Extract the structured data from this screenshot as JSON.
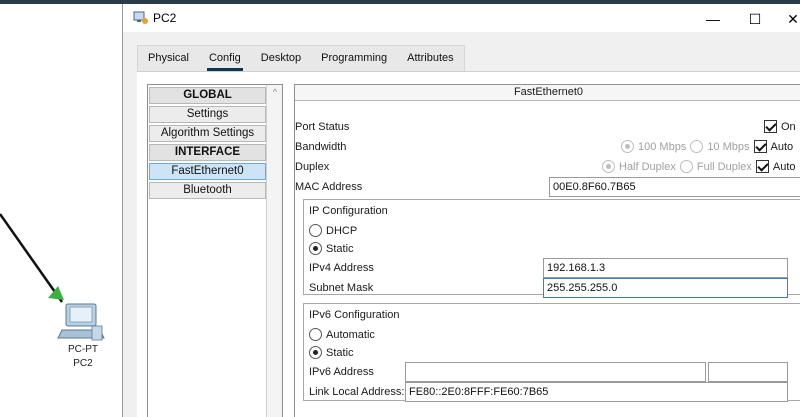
{
  "workspace": {
    "device_type": "PC-PT",
    "device_name": "PC2"
  },
  "window": {
    "title": "PC2",
    "minimize": "—",
    "maximize": "☐",
    "close": "✕"
  },
  "tabs": [
    {
      "label": "Physical"
    },
    {
      "label": "Config"
    },
    {
      "label": "Desktop"
    },
    {
      "label": "Programming"
    },
    {
      "label": "Attributes"
    }
  ],
  "sidebar": {
    "global_header": "GLOBAL",
    "settings": "Settings",
    "algorithm_settings": "Algorithm Settings",
    "interface_header": "INTERFACE",
    "fastethernet": "FastEthernet0",
    "bluetooth": "Bluetooth"
  },
  "interface_panel": {
    "title": "FastEthernet0",
    "port_status_label": "Port Status",
    "port_status_on": "On",
    "bandwidth_label": "Bandwidth",
    "bw_100": "100 Mbps",
    "bw_10": "10 Mbps",
    "bw_auto": "Auto",
    "duplex_label": "Duplex",
    "half_duplex": "Half Duplex",
    "full_duplex": "Full Duplex",
    "duplex_auto": "Auto",
    "mac_label": "MAC Address",
    "mac_value": "00E0.8F60.7B65"
  },
  "ip_config": {
    "title": "IP Configuration",
    "dhcp": "DHCP",
    "static": "Static",
    "ipv4_label": "IPv4 Address",
    "ipv4_value": "192.168.1.3",
    "mask_label": "Subnet Mask",
    "mask_value": "255.255.255.0"
  },
  "ipv6_config": {
    "title": "IPv6 Configuration",
    "automatic": "Automatic",
    "static": "Static",
    "ipv6_label": "IPv6 Address",
    "ipv6_value": "",
    "prefix_value": "",
    "link_local_label": "Link Local Address:",
    "link_local_value": "FE80::2E0:8FFF:FE60:7B65"
  },
  "colors": {
    "accent": "#0b3553",
    "link_green": "#3cb043",
    "selected_item": "#cde4f7"
  }
}
